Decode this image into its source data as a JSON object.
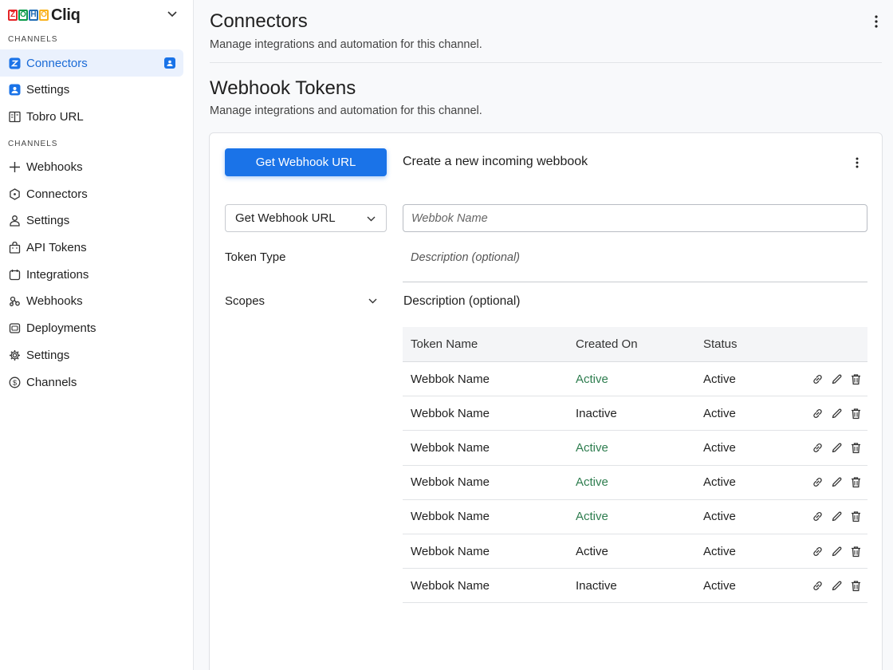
{
  "app": {
    "brand_letters": [
      "Z",
      "O",
      "H",
      "O"
    ],
    "brand_letter_colors": [
      "#e42527",
      "#089949",
      "#226db4",
      "#f9b21d"
    ],
    "brand_name": "Cliq",
    "brand_menu_icon": "chevron-down-icon"
  },
  "sidebar": {
    "section1_label": "CHANNELS",
    "section1_items": [
      {
        "label": "Connectors",
        "icon": "zoho-z-icon",
        "active": true,
        "badge_icon": "bookmark-person-icon"
      },
      {
        "label": "Settings",
        "icon": "user-square-icon"
      },
      {
        "label": "Tobro URL",
        "icon": "book-icon"
      }
    ],
    "section2_label": "CHANNELS",
    "section2_items": [
      {
        "label": "Webhooks",
        "icon": "plus-icon"
      },
      {
        "label": "Connectors",
        "icon": "hexagon-icon"
      },
      {
        "label": "Settings",
        "icon": "person-icon"
      },
      {
        "label": "API Tokens",
        "icon": "bag-icon"
      },
      {
        "label": "Integrations",
        "icon": "calendar-icon"
      },
      {
        "label": "Webhooks",
        "icon": "webhook-icon"
      },
      {
        "label": "Deployments",
        "icon": "server-icon"
      },
      {
        "label": "Settings",
        "icon": "gear-icon"
      },
      {
        "label": "Channels",
        "icon": "dollar-circle-icon"
      }
    ]
  },
  "header": {
    "title": "Connectors",
    "subtitle": "Manage integrations and automation for this channel."
  },
  "section": {
    "title": "Webhook Tokens",
    "subtitle": "Manage integrations and automation for this channel."
  },
  "card": {
    "primary_button": "Get Webhook URL",
    "heading": "Create a new incoming webbook",
    "select_value": "Get Webhook URL",
    "name_placeholder": "Webbok Name",
    "token_type_label": "Token Type",
    "description_placeholder": "Description (optional)",
    "scopes_label": "Scopes",
    "description_label": "Description (optional)"
  },
  "table": {
    "columns": [
      "Token Name",
      "Created On",
      "Status"
    ],
    "rows": [
      {
        "name": "Webbok Name",
        "created": "Active",
        "status": "Active",
        "created_color": "#2e7d4f"
      },
      {
        "name": "Webbok Name",
        "created": "Inactive",
        "status": "Active",
        "created_color": "#1f1f1f"
      },
      {
        "name": "Webbok Name",
        "created": "Active",
        "status": "Active",
        "created_color": "#2e7d4f"
      },
      {
        "name": "Webbok Name",
        "created": "Active",
        "status": "Active",
        "created_color": "#2e7d4f"
      },
      {
        "name": "Webbok Name",
        "created": "Active",
        "status": "Active",
        "created_color": "#2e7d4f"
      },
      {
        "name": "Webbok Name",
        "created": "Active",
        "status": "Active",
        "created_color": "#1f1f1f"
      },
      {
        "name": "Webbok Name",
        "created": "Inactive",
        "status": "Active",
        "created_color": "#1f1f1f"
      }
    ],
    "row_actions": [
      "link-icon",
      "edit-icon",
      "trash-icon"
    ]
  },
  "colors": {
    "accent": "#1a73e8",
    "active_nav_bg": "#eaf1fd",
    "status_green": "#2e7d4f"
  }
}
